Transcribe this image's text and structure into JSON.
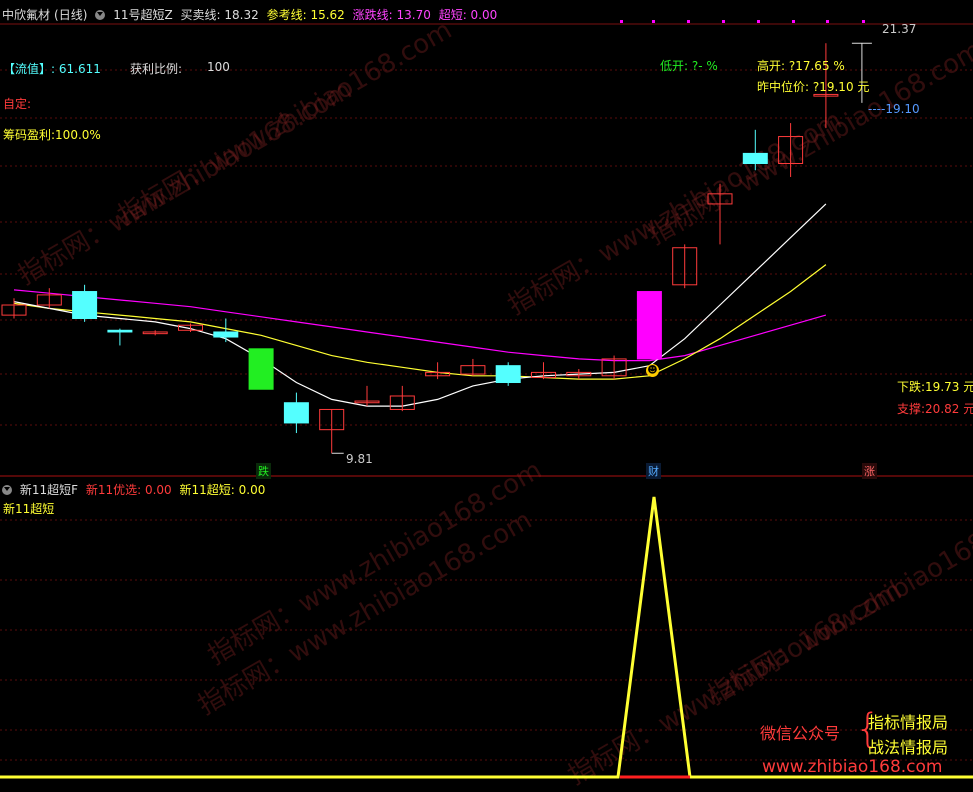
{
  "top_header": {
    "stock": "中欣氟材",
    "period": "(日线)",
    "indicator": "11号超短Z",
    "buy_sell_label": "买卖线: 18.32",
    "ref_label": "参考线: 15.62",
    "rise_fall_label": "涨跌线: 13.70",
    "ultra_label": "超短: 0.00"
  },
  "info": {
    "float_label": "【流值】: 61.611",
    "profit_ratio_label": "获利比例:",
    "profit_ratio_value": "100",
    "custom_label": "自定:",
    "chip_profit_label": "筹码盈利:100.0%",
    "low_open": "低开: ?- %",
    "high_open": "高开: ?17.65 %",
    "prev_mid": "昨中位价: ?19.10 元"
  },
  "price_labels": {
    "high": "21.37",
    "level": "----19.10",
    "low": "9.81",
    "down": "下跌:19.73 元",
    "support": "支撑:20.82 元"
  },
  "signals": {
    "die": "跌",
    "cai": "财",
    "zhang": "涨"
  },
  "bottom_header": {
    "indicator": "新11超短F",
    "priority": "新11优选: 0.00",
    "ultra": "新11超短: 0.00",
    "sub_label": "新11超短"
  },
  "promo": {
    "wechat": "微信公众号",
    "brace": "{",
    "name1": "指标情报局",
    "name2": "战法情报局",
    "site": "www.zhibiao168.com"
  },
  "watermarks": {
    "cn": "指标网：",
    "url": "www.zhibiao168.com"
  },
  "colors": {
    "up": "#ff3b3b",
    "down_cyan": "#54ffff",
    "magenta": "#ff00ff",
    "yellow": "#ffff33",
    "white": "#ffffff",
    "green": "#22ee22"
  },
  "candles": [
    {
      "o": 13.3,
      "c": 13.6,
      "h": 13.8,
      "l": 13.2,
      "type": "up"
    },
    {
      "o": 13.6,
      "c": 13.9,
      "h": 14.1,
      "l": 13.5,
      "type": "up"
    },
    {
      "o": 14.0,
      "c": 13.2,
      "h": 14.2,
      "l": 13.1,
      "type": "down"
    },
    {
      "o": 12.85,
      "c": 12.8,
      "h": 12.9,
      "l": 12.4,
      "type": "down"
    },
    {
      "o": 12.75,
      "c": 12.8,
      "h": 12.85,
      "l": 12.7,
      "type": "up"
    },
    {
      "o": 12.85,
      "c": 13.0,
      "h": 13.05,
      "l": 12.8,
      "type": "up"
    },
    {
      "o": 12.8,
      "c": 12.65,
      "h": 13.2,
      "l": 12.5,
      "type": "down"
    },
    {
      "o": 12.3,
      "c": 11.1,
      "h": 12.3,
      "l": 11.1,
      "type": "green"
    },
    {
      "o": 10.7,
      "c": 10.1,
      "h": 11.0,
      "l": 9.8,
      "type": "down"
    },
    {
      "o": 9.9,
      "c": 10.5,
      "h": 10.5,
      "l": 9.2,
      "type": "up"
    },
    {
      "o": 10.7,
      "c": 10.75,
      "h": 11.2,
      "l": 10.6,
      "type": "up"
    },
    {
      "o": 10.5,
      "c": 10.9,
      "h": 11.2,
      "l": 10.45,
      "type": "up"
    },
    {
      "o": 11.5,
      "c": 11.6,
      "h": 11.9,
      "l": 11.4,
      "type": "up"
    },
    {
      "o": 11.55,
      "c": 11.8,
      "h": 12.0,
      "l": 11.5,
      "type": "up"
    },
    {
      "o": 11.8,
      "c": 11.3,
      "h": 11.9,
      "l": 11.2,
      "type": "down"
    },
    {
      "o": 11.45,
      "c": 11.6,
      "h": 11.9,
      "l": 11.4,
      "type": "up"
    },
    {
      "o": 11.5,
      "c": 11.6,
      "h": 11.7,
      "l": 11.4,
      "type": "up"
    },
    {
      "o": 11.5,
      "c": 12.0,
      "h": 12.1,
      "l": 11.4,
      "type": "up"
    },
    {
      "o": 12.0,
      "c": 14.0,
      "h": 14.0,
      "l": 12.0,
      "type": "magenta"
    },
    {
      "o": 14.2,
      "c": 15.3,
      "h": 15.4,
      "l": 14.1,
      "type": "up"
    },
    {
      "o": 16.6,
      "c": 16.9,
      "h": 17.2,
      "l": 15.4,
      "type": "up"
    },
    {
      "o": 18.1,
      "c": 17.8,
      "h": 18.8,
      "l": 17.6,
      "type": "down"
    },
    {
      "o": 17.8,
      "c": 18.6,
      "h": 19.0,
      "l": 17.4,
      "type": "up"
    },
    {
      "o": 19.8,
      "c": 19.85,
      "h": 21.37,
      "l": 18.85,
      "type": "up"
    }
  ],
  "lines": {
    "white": [
      13.7,
      13.5,
      13.3,
      13.2,
      13.1,
      12.9,
      12.6,
      12.0,
      11.3,
      10.8,
      10.6,
      10.6,
      10.8,
      11.2,
      11.4,
      11.5,
      11.55,
      11.6,
      11.8,
      12.6,
      13.6,
      14.6,
      15.6,
      16.6
    ],
    "yellow": [
      13.65,
      13.5,
      13.4,
      13.3,
      13.2,
      13.1,
      12.9,
      12.7,
      12.4,
      12.1,
      11.9,
      11.75,
      11.6,
      11.5,
      11.5,
      11.45,
      11.4,
      11.4,
      11.5,
      12.0,
      12.6,
      13.3,
      14.0,
      14.8
    ],
    "magenta": [
      14.05,
      13.95,
      13.85,
      13.75,
      13.65,
      13.55,
      13.4,
      13.25,
      13.1,
      12.95,
      12.8,
      12.65,
      12.5,
      12.35,
      12.2,
      12.1,
      12.0,
      11.95,
      11.95,
      12.1,
      12.4,
      12.7,
      13.0,
      13.3
    ]
  },
  "sub_series": [
    0,
    0,
    0,
    0,
    0,
    0,
    0,
    0,
    0,
    0,
    0,
    0,
    0,
    0,
    0,
    0,
    0,
    0,
    1,
    0,
    0,
    0,
    0,
    0
  ]
}
